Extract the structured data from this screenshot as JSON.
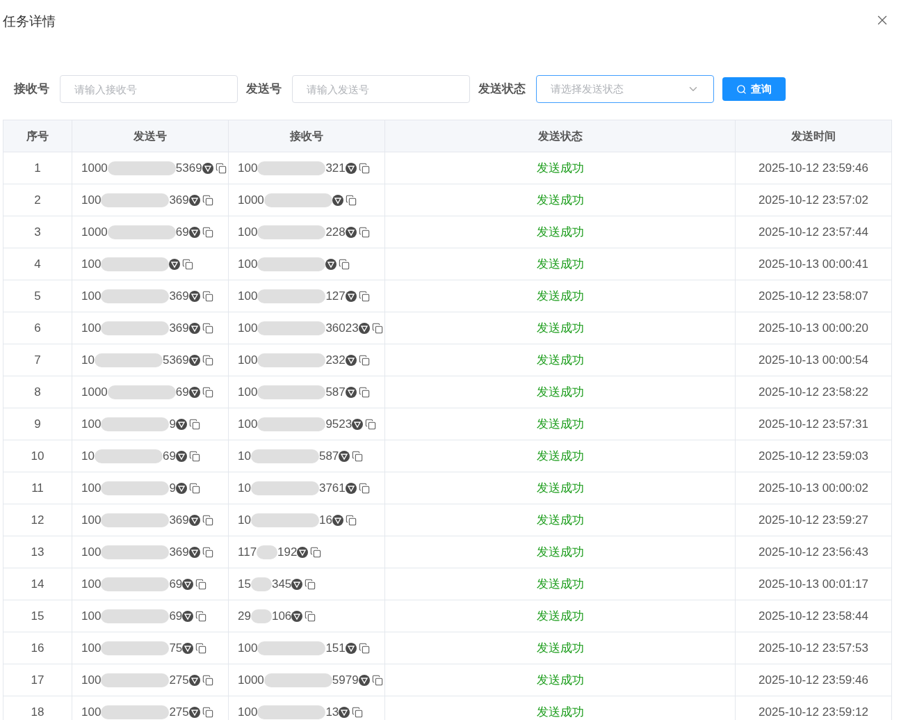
{
  "dialog": {
    "title": "任务详情"
  },
  "filters": [
    {
      "kind": "input",
      "label": "接收号",
      "placeholder": "请输入接收号"
    },
    {
      "kind": "input",
      "label": "发送号",
      "placeholder": "请输入发送号"
    },
    {
      "kind": "select",
      "label": "发送状态",
      "placeholder": "请选择发送状态"
    }
  ],
  "search_button": "查询",
  "table": {
    "columns": [
      "序号",
      "发送号",
      "接收号",
      "发送状态",
      "发送时间"
    ],
    "rows": [
      {
        "index": "1",
        "sender": {
          "prefix": "1000",
          "suffix": "5369"
        },
        "receiver": {
          "prefix": "100",
          "suffix": "321"
        },
        "status": "发送成功",
        "time": "2025-10-12 23:59:46"
      },
      {
        "index": "2",
        "sender": {
          "prefix": "100",
          "suffix": "369"
        },
        "receiver": {
          "prefix": "1000"
        },
        "status": "发送成功",
        "time": "2025-10-12 23:57:02"
      },
      {
        "index": "3",
        "sender": {
          "prefix": "1000",
          "suffix": "69"
        },
        "receiver": {
          "prefix": "100",
          "suffix": "228"
        },
        "status": "发送成功",
        "time": "2025-10-12 23:57:44"
      },
      {
        "index": "4",
        "sender": {
          "prefix": "100"
        },
        "receiver": {
          "prefix": "100"
        },
        "status": "发送成功",
        "time": "2025-10-13 00:00:41"
      },
      {
        "index": "5",
        "sender": {
          "prefix": "100",
          "suffix": "369"
        },
        "receiver": {
          "prefix": "100",
          "suffix": "127"
        },
        "status": "发送成功",
        "time": "2025-10-12 23:58:07"
      },
      {
        "index": "6",
        "sender": {
          "prefix": "100",
          "suffix": "369"
        },
        "receiver": {
          "prefix": "100",
          "suffix": "36023"
        },
        "status": "发送成功",
        "time": "2025-10-13 00:00:20"
      },
      {
        "index": "7",
        "sender": {
          "prefix": "10",
          "suffix": "5369"
        },
        "receiver": {
          "prefix": "100",
          "suffix": "232"
        },
        "status": "发送成功",
        "time": "2025-10-13 00:00:54"
      },
      {
        "index": "8",
        "sender": {
          "prefix": "1000",
          "suffix": "69"
        },
        "receiver": {
          "prefix": "100",
          "suffix": "587"
        },
        "status": "发送成功",
        "time": "2025-10-12 23:58:22"
      },
      {
        "index": "9",
        "sender": {
          "prefix": "100",
          "suffix": "9"
        },
        "receiver": {
          "prefix": "100",
          "suffix": "9523"
        },
        "status": "发送成功",
        "time": "2025-10-12 23:57:31"
      },
      {
        "index": "10",
        "sender": {
          "prefix": "10",
          "suffix": "69"
        },
        "receiver": {
          "prefix": "10",
          "suffix": "587"
        },
        "status": "发送成功",
        "time": "2025-10-12 23:59:03"
      },
      {
        "index": "11",
        "sender": {
          "prefix": "100",
          "suffix": "9"
        },
        "receiver": {
          "prefix": "10",
          "suffix": "3761"
        },
        "status": "发送成功",
        "time": "2025-10-13 00:00:02"
      },
      {
        "index": "12",
        "sender": {
          "prefix": "100",
          "suffix": "369"
        },
        "receiver": {
          "prefix": "10",
          "suffix": "16"
        },
        "status": "发送成功",
        "time": "2025-10-12 23:59:27"
      },
      {
        "index": "13",
        "sender": {
          "prefix": "100",
          "suffix": "369"
        },
        "receiver": {
          "prefix": "117",
          "suffix": "192"
        },
        "status": "发送成功",
        "time": "2025-10-12 23:56:43"
      },
      {
        "index": "14",
        "sender": {
          "prefix": "100",
          "suffix": "69"
        },
        "receiver": {
          "prefix": "15",
          "suffix": "345"
        },
        "status": "发送成功",
        "time": "2025-10-13 00:01:17"
      },
      {
        "index": "15",
        "sender": {
          "prefix": "100",
          "suffix": "69"
        },
        "receiver": {
          "prefix": "29",
          "suffix": "106"
        },
        "status": "发送成功",
        "time": "2025-10-12 23:58:44"
      },
      {
        "index": "16",
        "sender": {
          "prefix": "100",
          "suffix": "75"
        },
        "receiver": {
          "prefix": "100",
          "suffix": "151"
        },
        "status": "发送成功",
        "time": "2025-10-12 23:57:53"
      },
      {
        "index": "17",
        "sender": {
          "prefix": "100",
          "suffix": "275"
        },
        "receiver": {
          "prefix": "1000",
          "suffix": "5979"
        },
        "status": "发送成功",
        "time": "2025-10-12 23:59:46"
      },
      {
        "index": "18",
        "sender": {
          "prefix": "100",
          "suffix": "275"
        },
        "receiver": {
          "prefix": "100",
          "suffix": "13"
        },
        "status": "发送成功",
        "time": "2025-10-12 23:59:12"
      }
    ]
  }
}
